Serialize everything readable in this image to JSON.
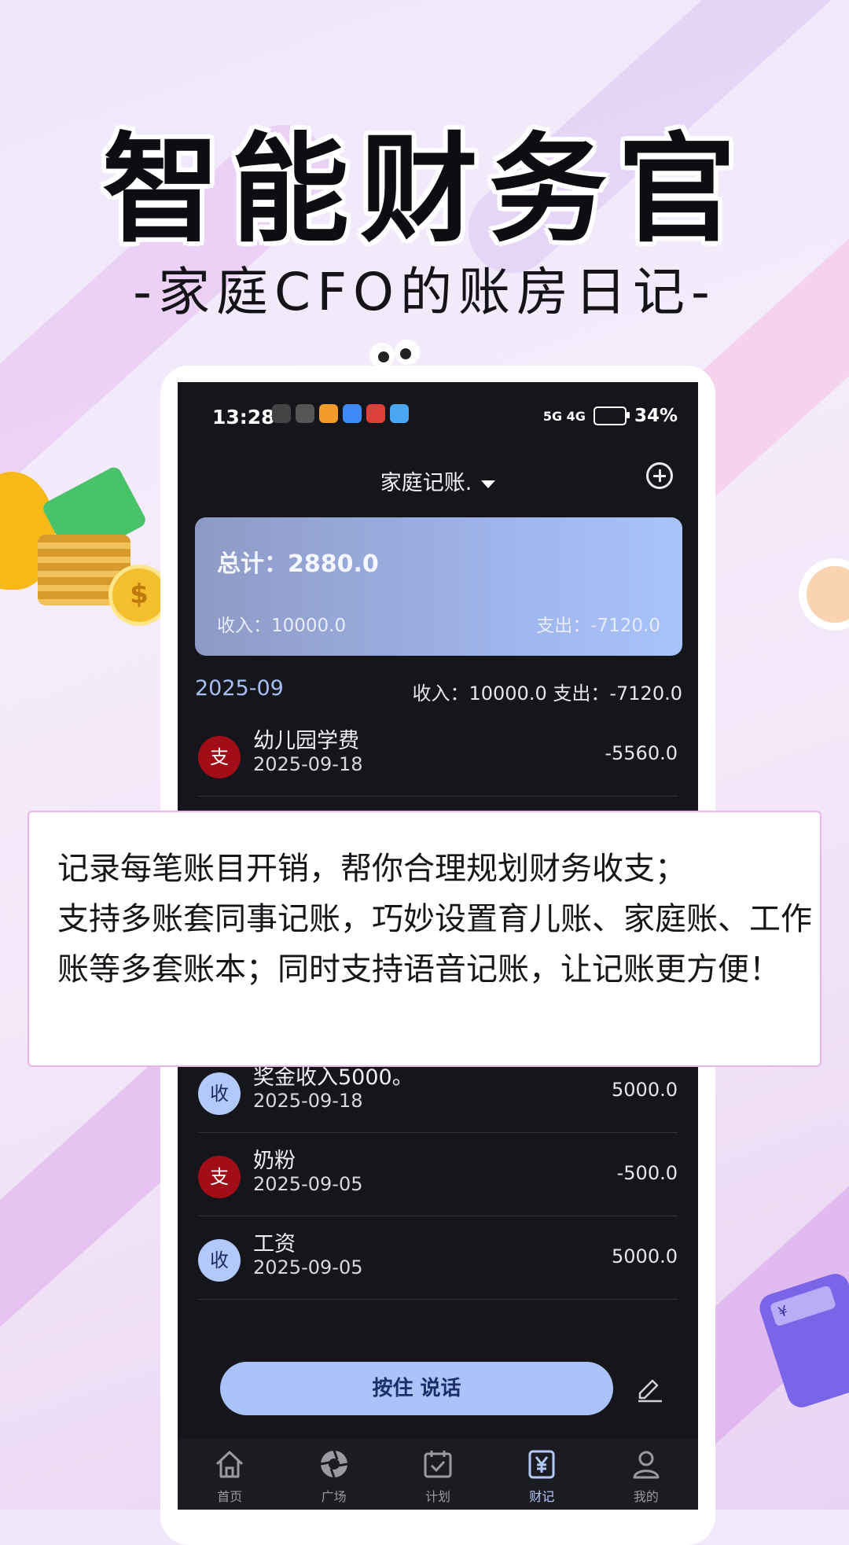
{
  "poster": {
    "headline": "智能财务官",
    "subheadline": "-家庭CFO的账房日记-"
  },
  "status_bar": {
    "time": "13:28",
    "battery": "34%",
    "network": "5G 4G"
  },
  "topbar": {
    "title": "家庭记账.",
    "add_icon": "plus-circle-icon"
  },
  "summary": {
    "total": "总计：2880.0",
    "income": "收入：10000.0",
    "expense": "支出：-7120.0"
  },
  "month_group": {
    "month": "2025-09",
    "summary": "收入：10000.0  支出：-7120.0"
  },
  "transactions": [
    {
      "type_label": "支",
      "title": "幼儿园学费",
      "date": "2025-09-18",
      "amount": "-5560.0"
    },
    {
      "type_label": "收",
      "title": "奖金收入5000。",
      "date": "2025-09-18",
      "amount": "5000.0"
    },
    {
      "type_label": "支",
      "title": "奶粉",
      "date": "2025-09-05",
      "amount": "-500.0"
    },
    {
      "type_label": "收",
      "title": "工资",
      "date": "2025-09-05",
      "amount": "5000.0"
    }
  ],
  "voice": {
    "button_label": "按住 说话",
    "edit_icon": "pencil-icon"
  },
  "tabs": [
    {
      "label": "首页",
      "icon": "home-icon"
    },
    {
      "label": "广场",
      "icon": "aperture-icon"
    },
    {
      "label": "计划",
      "icon": "calendar-check-icon"
    },
    {
      "label": "财记",
      "icon": "ledger-yen-icon"
    },
    {
      "label": "我的",
      "icon": "user-icon"
    }
  ],
  "overlay": {
    "line1": "记录每笔账目开销，帮你合理规划财务收支；",
    "line2": "支持多账套同事记账，巧妙设置育儿账、家庭账、工作账等多套账本；同时支持语音记账，让记账更方便！"
  },
  "decorations": {
    "coin_symbol": "$",
    "calculator_symbol": "¥"
  },
  "colors": {
    "accent_blue": "#aac4fb",
    "expense_red": "#a20e18",
    "screen_bg": "#15161b"
  }
}
